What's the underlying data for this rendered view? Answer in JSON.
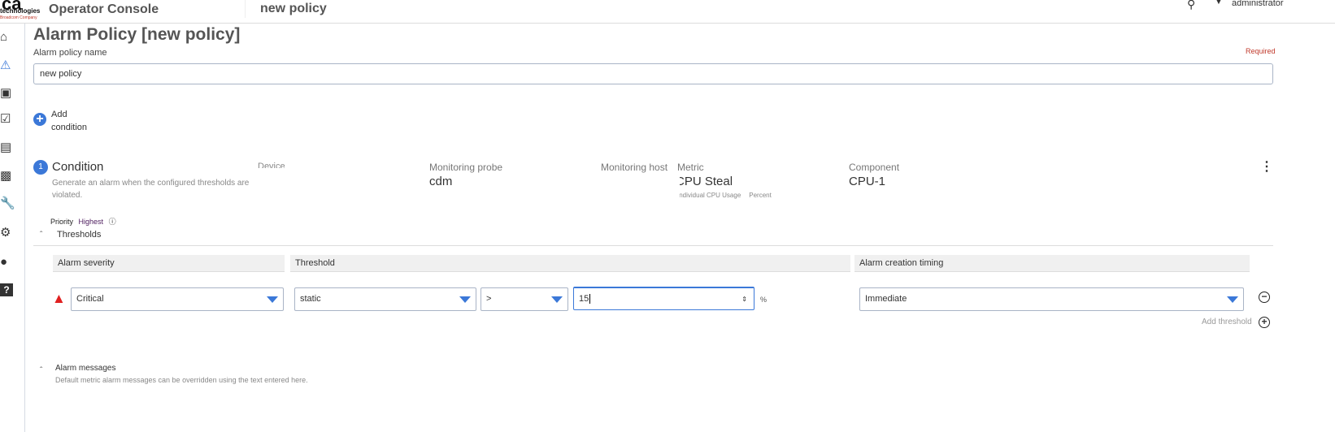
{
  "header": {
    "logo_text": "ca",
    "logo_sub": "technologies",
    "logo_company": "Broadcom Company",
    "app_title": "Operator Console",
    "page_title": "new policy",
    "user": "administrator"
  },
  "sidebar": {
    "items": [
      "home",
      "alarms",
      "devices",
      "reports",
      "dashboards",
      "analytics",
      "tools",
      "settings",
      "chat",
      "help"
    ]
  },
  "page": {
    "title": "Alarm Policy [new policy]",
    "name_label": "Alarm policy name",
    "required": "Required",
    "name_value": "new policy",
    "add_condition_line1": "Add",
    "add_condition_line2": "condition"
  },
  "condition": {
    "number": "1",
    "title": "Condition",
    "description": "Generate an alarm when the configured thresholds are violated.",
    "device_label": "Device",
    "probe_label": "Monitoring probe",
    "probe_value": "cdm",
    "host_label": "Monitoring host",
    "metric_label": "Metric",
    "metric_value": "CPU Steal",
    "metric_sub1": "Individual CPU Usage",
    "metric_sub2": "Percent",
    "component_label": "Component",
    "component_value": "CPU-1",
    "priority_label": "Priority",
    "priority_value": "Highest"
  },
  "thresholds": {
    "title": "Thresholds",
    "headers": [
      "Alarm severity",
      "Threshold",
      "Alarm creation timing"
    ],
    "severity": "Critical",
    "type": "static",
    "operator": ">",
    "value": "15",
    "unit": "%",
    "timing": "Immediate",
    "add_label": "Add threshold"
  },
  "messages": {
    "title": "Alarm messages",
    "description": "Default metric alarm messages can be overridden using the text entered here."
  },
  "colors": {
    "accent": "#3b78d8",
    "critical": "#e02020",
    "required": "#c0392b"
  }
}
